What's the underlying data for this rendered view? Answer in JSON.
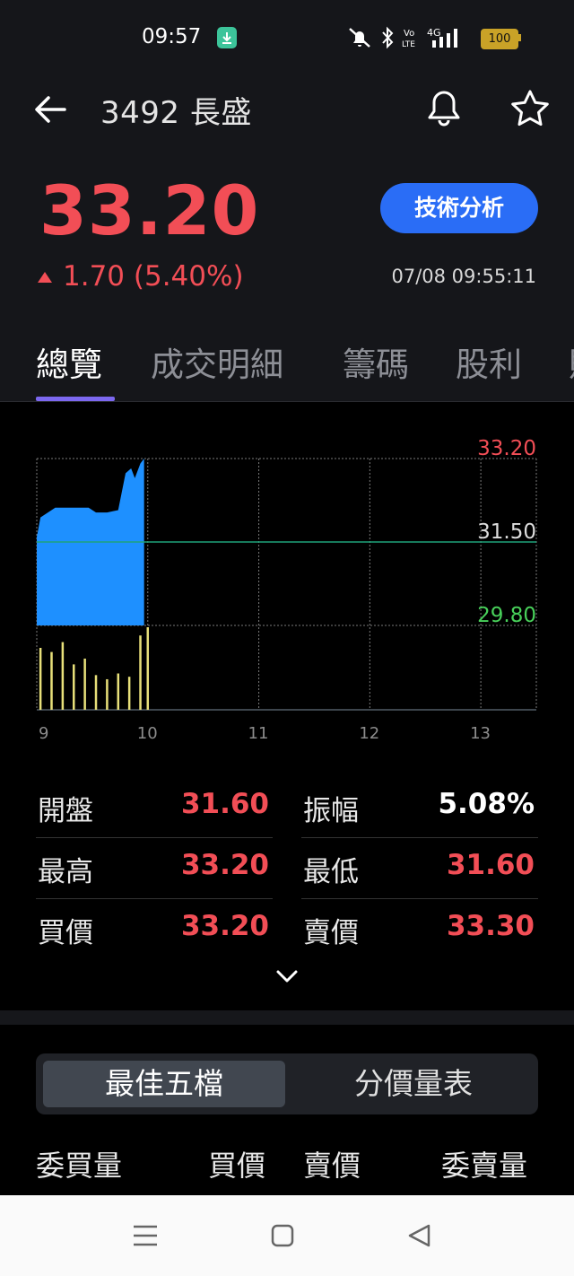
{
  "status_bar": {
    "time": "09:57",
    "icons": [
      "download-notification-icon",
      "mute-icon",
      "bluetooth-icon",
      "volte-icon",
      "4g-signal-icon"
    ],
    "battery": "100"
  },
  "header": {
    "title": "3492 長盛",
    "price": "33.20",
    "change": "1.70 (5.40%)",
    "timestamp": "07/08 09:55:11",
    "technical_analysis_label": "技術分析"
  },
  "tabs": [
    {
      "label": "總覽",
      "active": true
    },
    {
      "label": "成交明細",
      "active": false
    },
    {
      "label": "籌碼",
      "active": false
    },
    {
      "label": "股利",
      "active": false
    }
  ],
  "chart_data": {
    "type": "area",
    "y_labels": {
      "high": "33.20",
      "ref": "31.50",
      "low": "29.80"
    },
    "ylim": [
      29.8,
      33.2
    ],
    "x_ticks": [
      "9",
      "10",
      "11",
      "12",
      "13"
    ],
    "price_series": {
      "x_minutes": [
        0,
        2,
        10,
        28,
        32,
        38,
        44,
        48,
        51,
        53,
        56,
        58
      ],
      "price": [
        31.6,
        32.0,
        32.2,
        32.2,
        32.1,
        32.1,
        32.15,
        32.9,
        33.0,
        32.8,
        33.1,
        33.2
      ]
    },
    "volume_series": {
      "x_minutes": [
        2,
        8,
        14,
        20,
        26,
        32,
        38,
        44,
        50,
        56,
        60
      ],
      "relative_volume": [
        0.75,
        0.7,
        0.82,
        0.55,
        0.62,
        0.42,
        0.37,
        0.44,
        0.4,
        0.9,
        1.0
      ]
    },
    "colors": {
      "area": "#1e90ff",
      "ref_line": "#1fa37a",
      "volume": "#e8e07a",
      "high": "#f24e56",
      "low": "#48d05a",
      "ref": "#dddddd"
    }
  },
  "stats": [
    {
      "left": {
        "label": "開盤",
        "value": "31.60"
      },
      "right": {
        "label": "振幅",
        "value": "5.08%"
      }
    },
    {
      "left": {
        "label": "最高",
        "value": "33.20"
      },
      "right": {
        "label": "最低",
        "value": "31.60"
      }
    },
    {
      "left": {
        "label": "買價",
        "value": "33.20"
      },
      "right": {
        "label": "賣價",
        "value": "33.30"
      }
    }
  ],
  "order_book": {
    "segments": [
      "最佳五檔",
      "分價量表"
    ],
    "headers": [
      "委買量",
      "買價",
      "賣價",
      "委賣量"
    ]
  },
  "colors": {
    "up": "#f24e56",
    "accent": "#2a6df6",
    "tab_indicator": "#7c68f0"
  }
}
